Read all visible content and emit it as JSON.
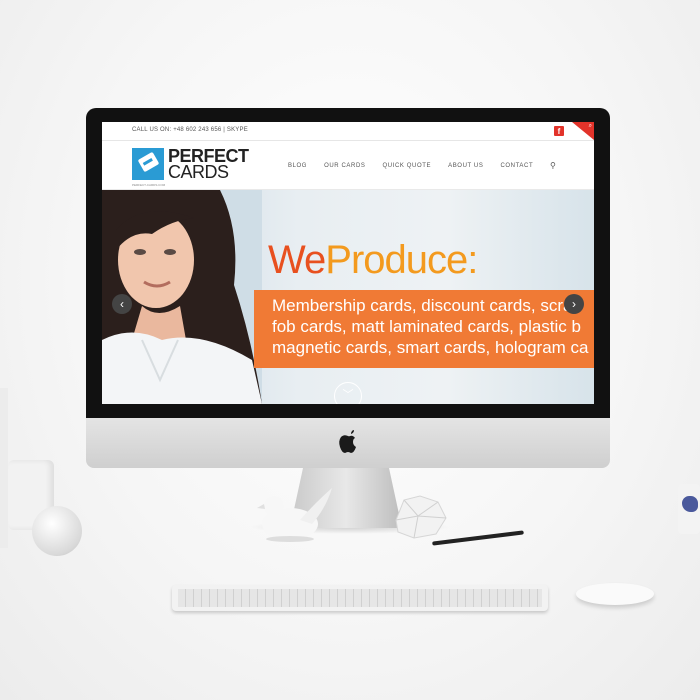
{
  "topbar": {
    "call_text": "CALL US ON: +48 602 243 656  |  SKYPE",
    "facebook_label": "f",
    "corner_icon": "search-icon"
  },
  "logo": {
    "line1": "PERFECT",
    "line2": "CARDS",
    "tagline": "PERFECT-CARDS.COM"
  },
  "nav": {
    "items": [
      "BLOG",
      "OUR CARDS",
      "QUICK QUOTE",
      "ABOUT US",
      "CONTACT"
    ],
    "search_icon": "magnifier"
  },
  "hero": {
    "headline_part1": "We",
    "headline_part2": "Produce:",
    "lines": [
      "Membership cards, discount cards, scra",
      "fob cards, matt laminated cards, plastic b",
      "magnetic cards, smart cards, hologram ca"
    ],
    "prev_arrow": "‹",
    "next_arrow": "›",
    "scroll_down": "﹀"
  },
  "colors": {
    "brand_blue": "#2a9bd4",
    "accent_orange": "#f07a35",
    "headline_red": "#e8501f",
    "headline_orange": "#f39a1e",
    "facebook_red": "#e2332a"
  }
}
